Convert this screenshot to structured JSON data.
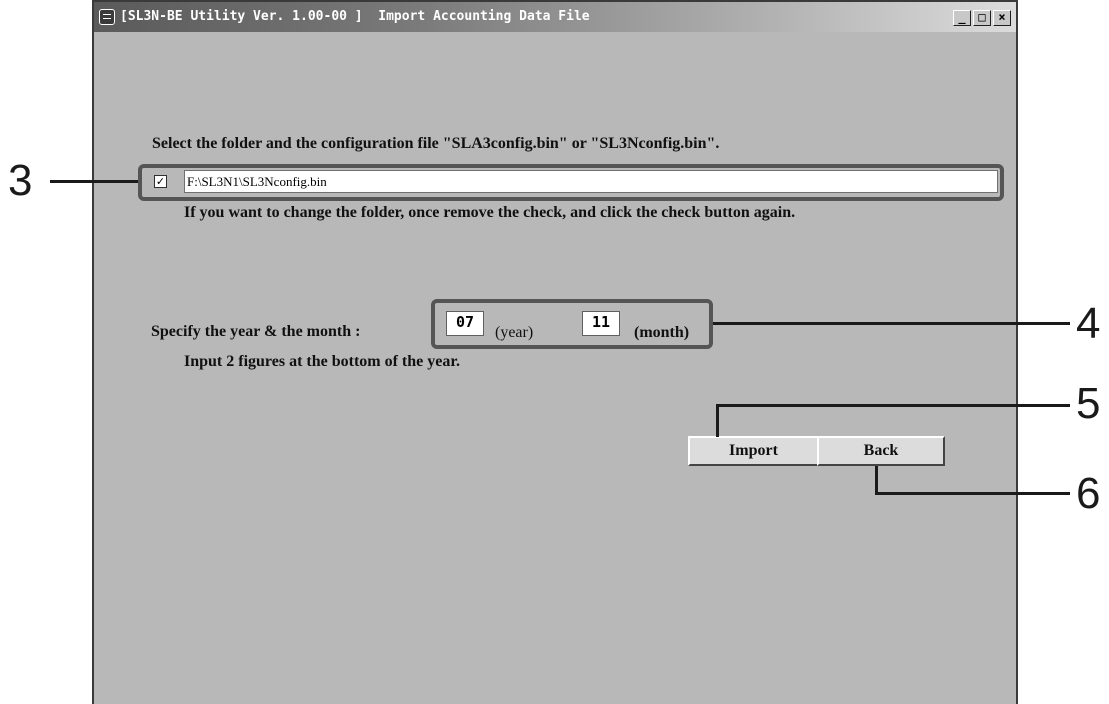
{
  "window": {
    "title": "[SL3N-BE Utility Ver. 1.00-00 ]  Import Accounting Data File",
    "minimize_glyph": "_",
    "maximize_glyph": "□",
    "close_glyph": "×"
  },
  "folder_section": {
    "instruction": "Select the folder and the configuration file \"SLA3config.bin\" or \"SL3Nconfig.bin\".",
    "checkbox_checked": true,
    "checkbox_glyph": "✓",
    "path_value": "F:\\SL3N1\\SL3Nconfig.bin",
    "hint": "If you want to change the folder, once remove the check, and click the check button again."
  },
  "date_section": {
    "label": "Specify the year & the month :",
    "year_value": "07",
    "year_unit": "(year)",
    "month_value": "11",
    "month_unit": "(month)",
    "hint": "Input 2 figures at the bottom of the year."
  },
  "buttons": {
    "import_label": "Import",
    "back_label": "Back"
  },
  "callouts": {
    "c3": "3",
    "c4": "4",
    "c5": "5",
    "c6": "6"
  },
  "colors": {
    "window_background": "#b8b8b8",
    "callout_frame": "#555555"
  }
}
